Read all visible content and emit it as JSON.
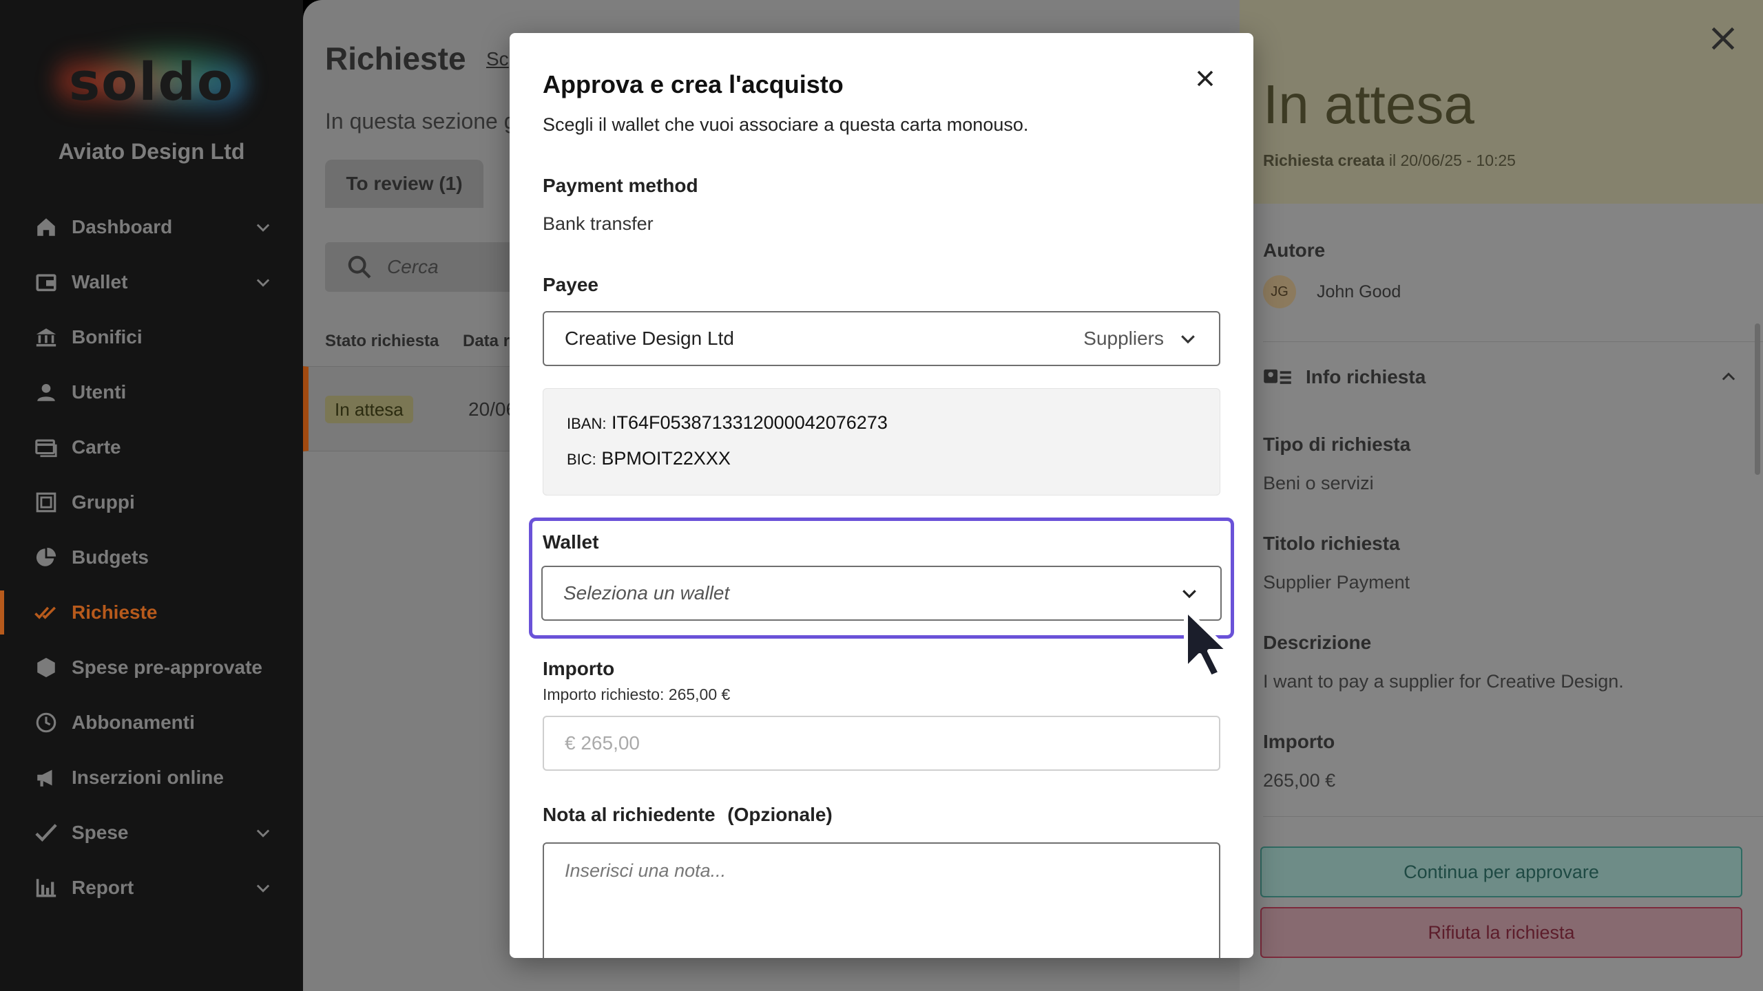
{
  "sidebar": {
    "logo": "soldo",
    "company": "Aviato Design Ltd",
    "items": [
      {
        "label": "Dashboard",
        "icon": "home-icon",
        "has_chevron": true
      },
      {
        "label": "Wallet",
        "icon": "wallet-icon",
        "has_chevron": true
      },
      {
        "label": "Bonifici",
        "icon": "bank-icon",
        "has_chevron": false
      },
      {
        "label": "Utenti",
        "icon": "user-icon",
        "has_chevron": false
      },
      {
        "label": "Carte",
        "icon": "cards-icon",
        "has_chevron": false
      },
      {
        "label": "Gruppi",
        "icon": "groups-icon",
        "has_chevron": false
      },
      {
        "label": "Budgets",
        "icon": "pie-icon",
        "has_chevron": false
      },
      {
        "label": "Richieste",
        "icon": "check-double-icon",
        "has_chevron": false,
        "active": true
      },
      {
        "label": "Spese pre-approvate",
        "icon": "shield-icon",
        "has_chevron": false
      },
      {
        "label": "Abbonamenti",
        "icon": "clock-icon",
        "has_chevron": false
      },
      {
        "label": "Inserzioni online",
        "icon": "megaphone-icon",
        "has_chevron": false
      },
      {
        "label": "Spese",
        "icon": "check-icon",
        "has_chevron": true
      },
      {
        "label": "Report",
        "icon": "bar-chart-icon",
        "has_chevron": true
      }
    ]
  },
  "main": {
    "title": "Richieste",
    "link": "Sc",
    "subtitle": "In questa sezione g",
    "tab": "To review (1)",
    "search_placeholder": "Cerca",
    "columns": [
      "Stato richiesta",
      "Data r"
    ],
    "row": {
      "status": "In attesa",
      "date": "20/06"
    }
  },
  "panel": {
    "status": "In attesa",
    "created_label": "Richiesta creata",
    "created_value": "il 20/06/25 - 10:25",
    "author_label": "Autore",
    "author_initials": "JG",
    "author_name": "John Good",
    "section_title": "Info richiesta",
    "type_label": "Tipo di richiesta",
    "type_value": "Beni o servizi",
    "title_label": "Titolo richiesta",
    "title_value": "Supplier Payment",
    "desc_label": "Descrizione",
    "desc_value": "I want to pay a supplier for Creative Design.",
    "amount_label": "Importo",
    "amount_value": "265,00 €",
    "approve_button": "Continua per approvare",
    "reject_button": "Rifiuta la richiesta"
  },
  "modal": {
    "title": "Approva e crea l'acquisto",
    "subtitle": "Scegli il wallet che vuoi associare a questa carta monouso.",
    "payment_method_label": "Payment method",
    "payment_method_value": "Bank transfer",
    "payee_label": "Payee",
    "payee_value": "Creative Design Ltd",
    "payee_category": "Suppliers",
    "iban_label": "IBAN:",
    "iban_value": "IT64F0538713312000042076273",
    "bic_label": "BIC:",
    "bic_value": "BPMOIT22XXX",
    "wallet_label": "Wallet",
    "wallet_placeholder": "Seleziona un wallet",
    "amount_label": "Importo",
    "amount_requested": "Importo richiesto: 265,00 €",
    "amount_placeholder": "€ 265,00",
    "note_label": "Nota al richiedente",
    "note_optional": "(Opzionale)",
    "note_placeholder": "Inserisci una nota..."
  },
  "colors": {
    "accent": "#6a52d8",
    "active_nav": "#b75a1c",
    "approve": "#2f6a62",
    "reject": "#7d2a3c"
  }
}
